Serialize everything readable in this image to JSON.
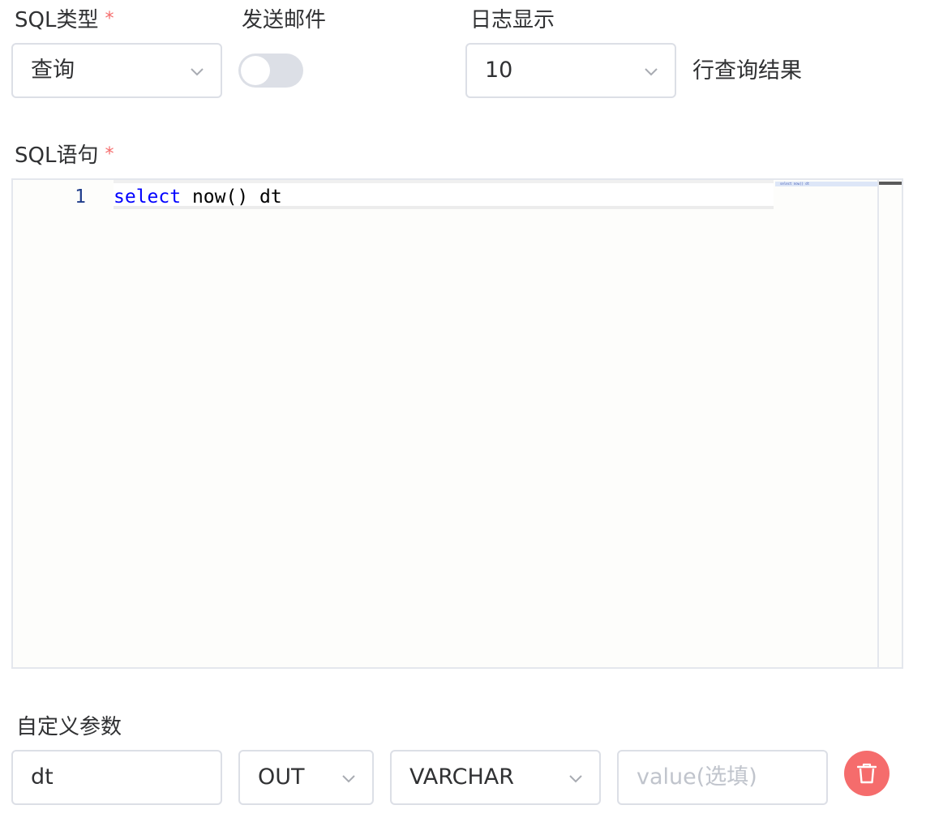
{
  "sql_type": {
    "label": "SQL类型",
    "required_mark": "*",
    "selected": "查询",
    "dropdown_icon": "chevron-down-icon"
  },
  "send_email": {
    "label": "发送邮件",
    "enabled": false
  },
  "log_display": {
    "label": "日志显示",
    "selected": "10",
    "suffix": "行查询结果",
    "dropdown_icon": "chevron-down-icon"
  },
  "sql_statement": {
    "label": "SQL语句",
    "required_mark": "*",
    "line_number": "1",
    "code_keyword": "select",
    "code_rest": " now() dt",
    "minimap_text": "select now() dt"
  },
  "custom_params": {
    "label": "自定义参数",
    "rows": [
      {
        "name": "dt",
        "direction": "OUT",
        "type": "VARCHAR",
        "value_placeholder": "value(选填)",
        "delete_icon": "trash-icon"
      }
    ]
  },
  "colors": {
    "required": "#f56c6c",
    "border": "#dcdfe6",
    "keyword": "#0000ff",
    "line_number": "#1f3c8a",
    "delete_button": "#f56c6c",
    "switch_off": "#dcdfe6"
  }
}
